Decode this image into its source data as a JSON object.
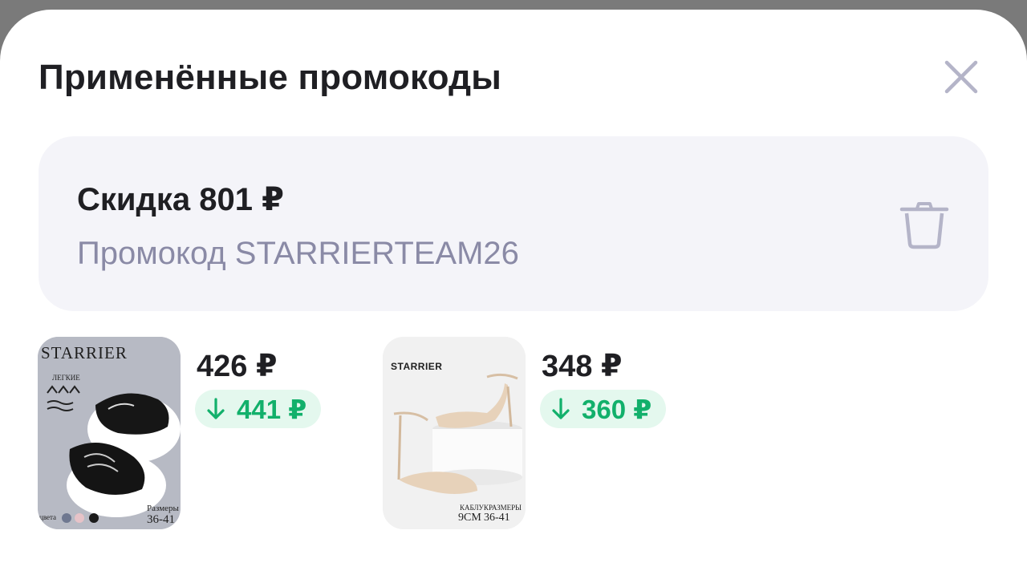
{
  "header": {
    "title": "Применённые промокоды"
  },
  "icons": {
    "close": "close-icon",
    "delete": "trash-icon",
    "price_drop": "arrow-down-icon"
  },
  "promo": {
    "title": "Скидка 801 ₽",
    "code_line": "Промокод STARRIERTEAM26"
  },
  "products": [
    {
      "price": "426 ₽",
      "old_price": "441 ₽",
      "image": {
        "brand": "STARRIER",
        "caption_top": "ЛЕГКИЕ",
        "caption_left": "цвета",
        "caption_right": "Размеры",
        "sizes": "36-41"
      }
    },
    {
      "price": "348 ₽",
      "old_price": "360 ₽",
      "image": {
        "brand": "STARRIER",
        "caption_left": "КАБЛУК",
        "caption_right": "РАЗМЕРЫ",
        "heel": "9СМ",
        "sizes": "36-41"
      }
    }
  ],
  "colors": {
    "accent_green": "#12b06b",
    "badge_bg": "#e4f8ee",
    "muted_text": "#8a8aa6",
    "card_bg": "#f4f4f9"
  }
}
